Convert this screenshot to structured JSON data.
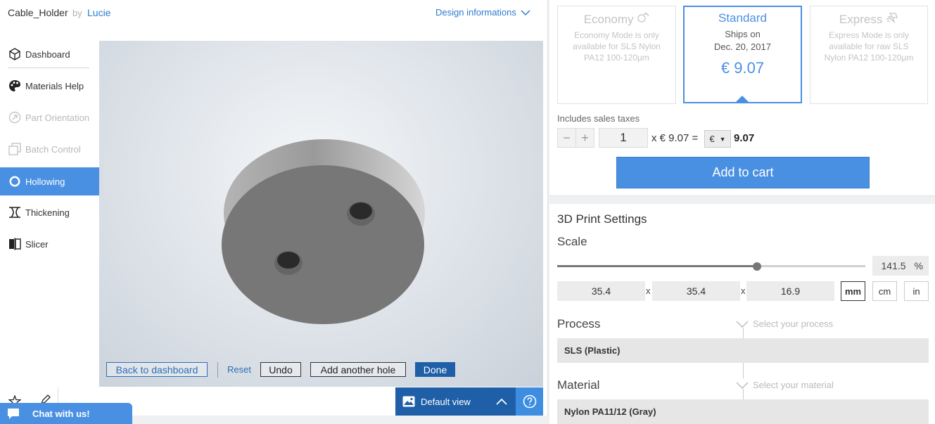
{
  "header": {
    "project_title": "Cable_Holder",
    "by_label": "by",
    "author": "Lucie",
    "design_info": "Design informations"
  },
  "sidebar": {
    "items": [
      {
        "label": "Dashboard",
        "icon": "cube-icon",
        "state": "normal"
      },
      {
        "label": "Materials Help",
        "icon": "palette-icon",
        "state": "normal"
      },
      {
        "label": "Part Orientation",
        "icon": "orientation-icon",
        "state": "disabled"
      },
      {
        "label": "Batch Control",
        "icon": "batch-icon",
        "state": "disabled"
      },
      {
        "label": "Hollowing",
        "icon": "hollow-circle-icon",
        "state": "active"
      },
      {
        "label": "Thickening",
        "icon": "thickening-icon",
        "state": "normal"
      },
      {
        "label": "Slicer",
        "icon": "slicer-icon",
        "state": "normal"
      }
    ]
  },
  "viewer": {
    "buttons": {
      "back": "Back to dashboard",
      "reset": "Reset",
      "undo": "Undo",
      "add_hole": "Add another hole",
      "done": "Done"
    },
    "default_view": "Default view"
  },
  "chat": {
    "label": "Chat with us!"
  },
  "pricing": {
    "tiers": [
      {
        "name": "Economy",
        "desc": "Economy Mode is only available for SLS Nylon PA12 100-120µm",
        "icon": "economy-icon"
      },
      {
        "name": "Standard",
        "desc_line1": "Ships on",
        "desc_line2": "Dec. 20, 2017",
        "price": "€ 9.07"
      },
      {
        "name": "Express",
        "desc": "Express Mode is only available for raw SLS Nylon PA12 100-120µm",
        "icon": "express-icon"
      }
    ],
    "tax_note": "Includes sales taxes",
    "quantity": "1",
    "unit_price": "x € 9.07 =",
    "currency": "€",
    "total": "9.07",
    "add_to_cart": "Add to cart"
  },
  "settings": {
    "title": "3D Print Settings",
    "scale_label": "Scale",
    "scale_value": "141.5",
    "scale_unit": "%",
    "scale_fraction": 0.648,
    "dims": {
      "x": "35.4",
      "y": "35.4",
      "z": "16.9",
      "sep": "x"
    },
    "units": [
      "mm",
      "cm",
      "in"
    ],
    "selected_unit": "mm",
    "process_label": "Process",
    "process_hint": "Select your process",
    "process_value": "SLS (Plastic)",
    "material_label": "Material",
    "material_hint": "Select your material",
    "material_value": "Nylon PA11/12 (Gray)"
  },
  "colors": {
    "accent": "#4a90e2",
    "dark_accent": "#1f5fa8",
    "link": "#2e7bcf"
  }
}
